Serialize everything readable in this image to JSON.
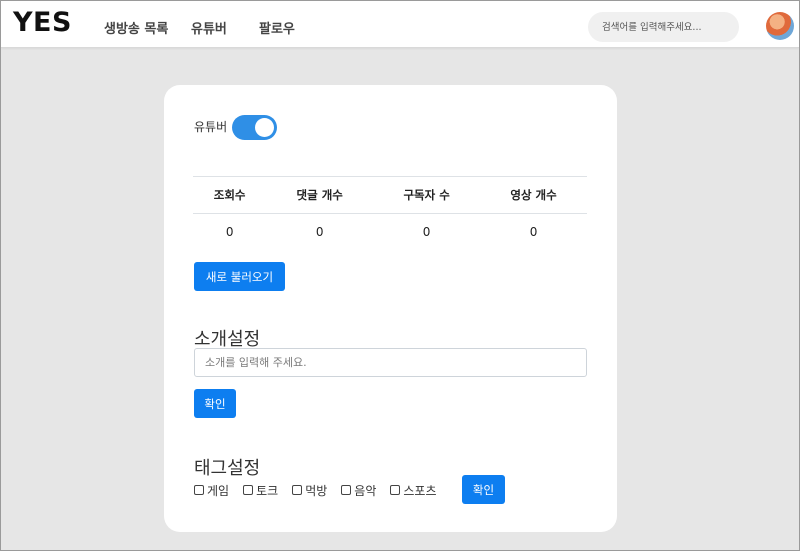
{
  "header": {
    "logo": "YES",
    "nav": [
      "생방송 목록",
      "유튜버",
      "팔로우"
    ],
    "search_placeholder": "검색어를 입력해주세요..."
  },
  "card": {
    "toggle_label": "유튜버",
    "toggle_on": true,
    "stats": {
      "headers": [
        "조회수",
        "댓글 개수",
        "구독자 수",
        "영상 개수"
      ],
      "values": [
        "0",
        "0",
        "0",
        "0"
      ]
    },
    "refresh_button": "새로 불러오기",
    "intro": {
      "title": "소개설정",
      "placeholder": "소개를 입력해 주세요.",
      "value": "",
      "confirm_button": "확인"
    },
    "tags": {
      "title": "태그설정",
      "options": [
        "게임",
        "토크",
        "먹방",
        "음악",
        "스포츠"
      ],
      "confirm_button": "확인"
    }
  },
  "colors": {
    "primary": "#0d7ef0",
    "toggle": "#2f8fe6",
    "background": "#e6e6e6"
  }
}
